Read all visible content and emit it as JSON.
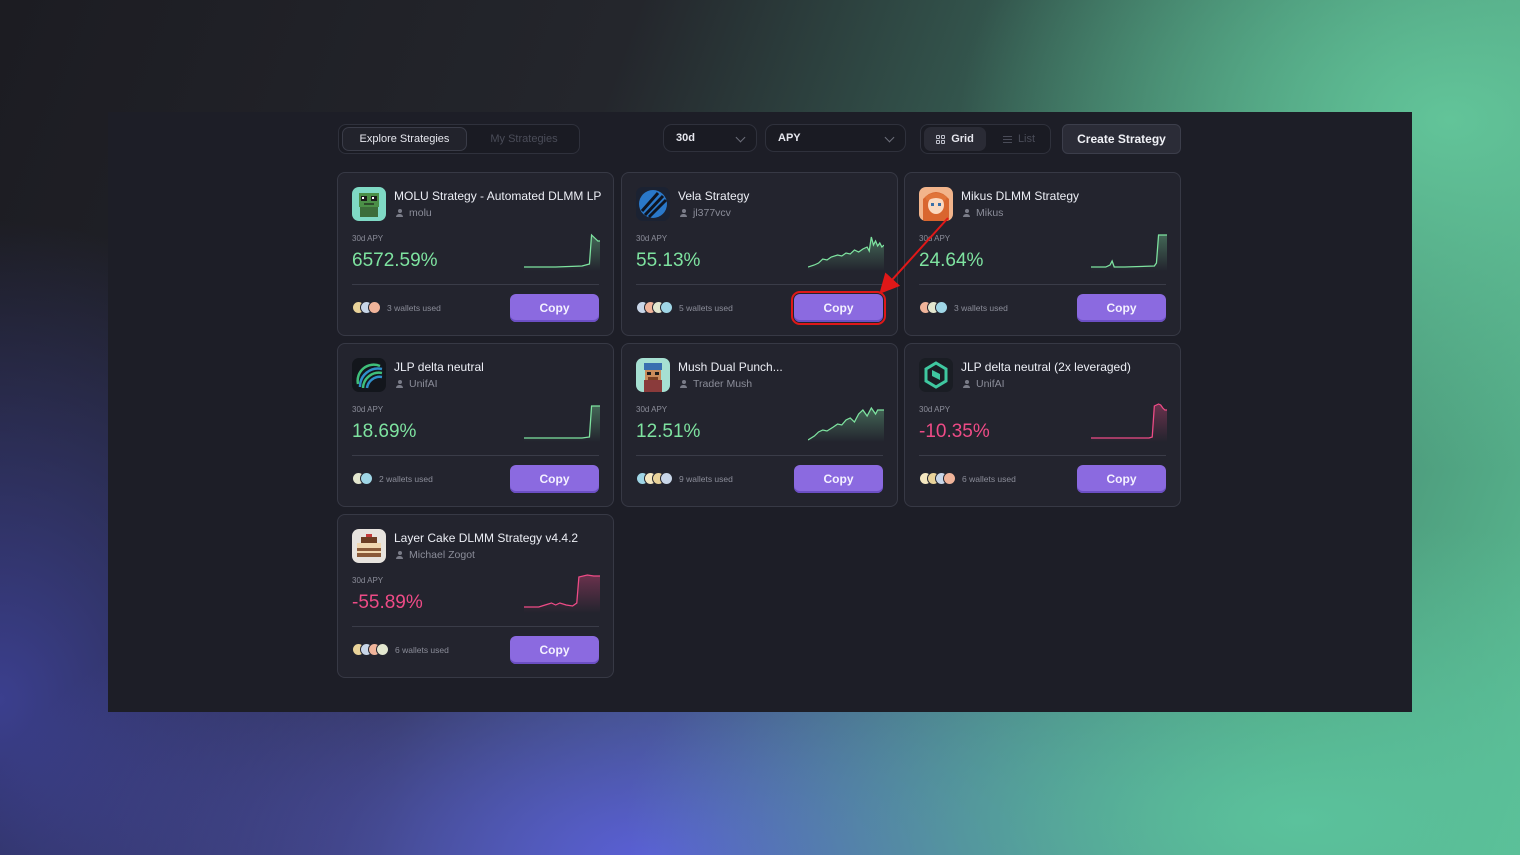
{
  "tabs": {
    "explore": "Explore Strategies",
    "mine": "My Strategies"
  },
  "filters": {
    "period": "30d",
    "sort": "APY"
  },
  "view": {
    "grid": "Grid",
    "list": "List"
  },
  "create_label": "Create Strategy",
  "colors": {
    "accent": "#8b6ae0",
    "positive": "#7ee3a0",
    "negative": "#ee4b86",
    "annotation": "#e01818"
  },
  "strategies": [
    {
      "name": "MOLU Strategy - Automated DLMM LP",
      "author": "molu",
      "apy_label": "30d APY",
      "apy": "6572.59%",
      "trend": "positive",
      "wallets": "3 wallets used",
      "copy": "Copy",
      "avatar_icon": "pixel-frog-icon"
    },
    {
      "name": "Vela Strategy",
      "author": "jl377vcv",
      "apy_label": "30d APY",
      "apy": "55.13%",
      "trend": "positive",
      "wallets": "5 wallets used",
      "copy": "Copy",
      "avatar_icon": "blue-stripes-icon"
    },
    {
      "name": "Mikus DLMM Strategy",
      "author": "Mikus",
      "apy_label": "30d APY",
      "apy": "24.64%",
      "trend": "positive",
      "wallets": "3 wallets used",
      "copy": "Copy",
      "avatar_icon": "anime-girl-icon"
    },
    {
      "name": "JLP delta neutral",
      "author": "UnifAI",
      "apy_label": "30d APY",
      "apy": "18.69%",
      "trend": "positive",
      "wallets": "2 wallets used",
      "copy": "Copy",
      "avatar_icon": "green-waves-icon"
    },
    {
      "name": "Mush Dual Punch...",
      "author": "Trader Mush",
      "apy_label": "30d APY",
      "apy": "12.51%",
      "trend": "positive",
      "wallets": "9 wallets used",
      "copy": "Copy",
      "avatar_icon": "pixel-character-icon"
    },
    {
      "name": "JLP delta neutral (2x leveraged)",
      "author": "UnifAI",
      "apy_label": "30d APY",
      "apy": "-10.35%",
      "trend": "negative",
      "wallets": "6 wallets used",
      "copy": "Copy",
      "avatar_icon": "hexagon-logo-icon"
    },
    {
      "name": "Layer Cake DLMM Strategy v4.4.2",
      "author": "Michael Zogot",
      "apy_label": "30d APY",
      "apy": "-55.89%",
      "trend": "negative",
      "wallets": "6 wallets used",
      "copy": "Copy",
      "avatar_icon": "cake-icon"
    }
  ]
}
